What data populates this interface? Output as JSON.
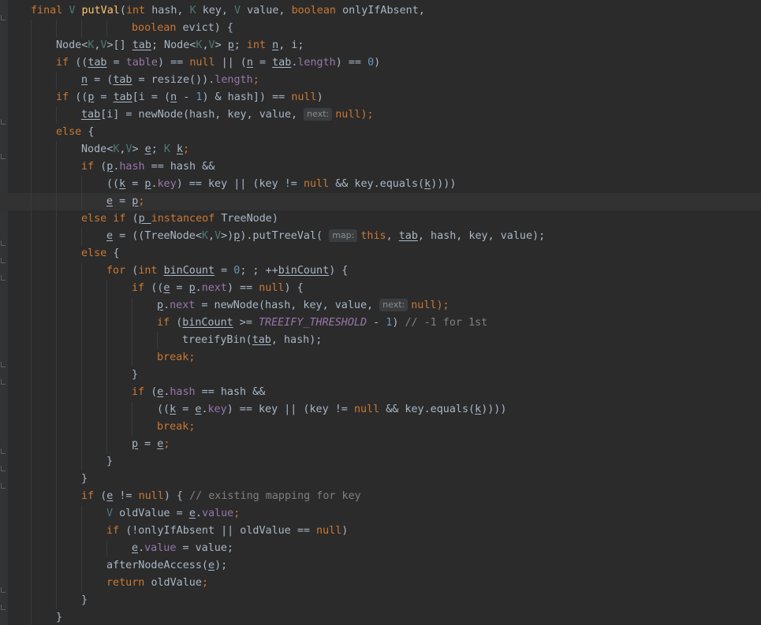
{
  "lines": [
    {
      "indent": 1,
      "tokens": [
        [
          "final ",
          "kw"
        ],
        [
          "V ",
          "tp"
        ],
        [
          "putVal",
          "fn"
        ],
        [
          "(",
          ""
        ],
        [
          "int ",
          "kw"
        ],
        [
          "hash, ",
          ""
        ],
        [
          "K ",
          "tp"
        ],
        [
          "key, ",
          ""
        ],
        [
          "V ",
          "tp"
        ],
        [
          "value, ",
          ""
        ],
        [
          "boolean ",
          "kw"
        ],
        [
          "onlyIfAbsent,",
          ""
        ]
      ]
    },
    {
      "indent": 5,
      "tokens": [
        [
          "boolean ",
          "kw"
        ],
        [
          "evict) {",
          ""
        ]
      ]
    },
    {
      "indent": 2,
      "tokens": [
        [
          "Node<",
          ""
        ],
        [
          "K",
          "tp"
        ],
        [
          ",",
          ""
        ],
        [
          "V",
          "tp"
        ],
        [
          ">[] ",
          ""
        ],
        [
          "tab",
          "ul"
        ],
        [
          "; Node<",
          ""
        ],
        [
          "K",
          "tp"
        ],
        [
          ",",
          ""
        ],
        [
          "V",
          "tp"
        ],
        [
          "> ",
          ""
        ],
        [
          "p",
          "ul"
        ],
        [
          "; ",
          ""
        ],
        [
          "int ",
          "kw"
        ],
        [
          "n",
          "ul"
        ],
        [
          ", i;",
          ""
        ]
      ]
    },
    {
      "indent": 2,
      "tokens": [
        [
          "if ",
          "kw"
        ],
        [
          "((",
          ""
        ],
        [
          "tab",
          "ul"
        ],
        [
          " = ",
          ""
        ],
        [
          "table",
          "fld"
        ],
        [
          ") == ",
          ""
        ],
        [
          "null",
          "kw"
        ],
        [
          " || (",
          ""
        ],
        [
          "n",
          "ul"
        ],
        [
          " = ",
          ""
        ],
        [
          "tab",
          "ul"
        ],
        [
          ".",
          ""
        ],
        [
          "length",
          "fld"
        ],
        [
          ") == ",
          ""
        ],
        [
          "0",
          "num"
        ],
        [
          ")",
          ""
        ]
      ]
    },
    {
      "indent": 3,
      "tokens": [
        [
          "n",
          "ul"
        ],
        [
          " = (",
          ""
        ],
        [
          "tab",
          "ul"
        ],
        [
          " = resize()).",
          ""
        ],
        [
          "length",
          "fld"
        ],
        [
          ";",
          "kw"
        ]
      ]
    },
    {
      "indent": 2,
      "tokens": [
        [
          "if ",
          "kw"
        ],
        [
          "((",
          ""
        ],
        [
          "p",
          "ul"
        ],
        [
          " = ",
          ""
        ],
        [
          "tab",
          "ul"
        ],
        [
          "[i = (",
          ""
        ],
        [
          "n",
          "ul"
        ],
        [
          " - ",
          ""
        ],
        [
          "1",
          "num"
        ],
        [
          ") & hash]) == ",
          ""
        ],
        [
          "null",
          "kw"
        ],
        [
          ")",
          ""
        ]
      ]
    },
    {
      "indent": 3,
      "tokens": [
        [
          "tab",
          "ul"
        ],
        [
          "[i] = newNode(hash, key, value, ",
          ""
        ],
        [
          "next:",
          "hint"
        ],
        [
          "null",
          "kw"
        ],
        [
          ");",
          "kw"
        ]
      ]
    },
    {
      "indent": 2,
      "tokens": [
        [
          "else ",
          "kw"
        ],
        [
          "{",
          ""
        ]
      ]
    },
    {
      "indent": 3,
      "tokens": [
        [
          "Node<",
          ""
        ],
        [
          "K",
          "tp"
        ],
        [
          ",",
          ""
        ],
        [
          "V",
          "tp"
        ],
        [
          "> ",
          ""
        ],
        [
          "e",
          "ul"
        ],
        [
          "; ",
          ""
        ],
        [
          "K ",
          "tp"
        ],
        [
          "k",
          "ul"
        ],
        [
          ";",
          "kw"
        ]
      ]
    },
    {
      "indent": 3,
      "tokens": [
        [
          "if ",
          "kw"
        ],
        [
          "(",
          ""
        ],
        [
          "p",
          "ul"
        ],
        [
          ".",
          ""
        ],
        [
          "hash",
          "fld"
        ],
        [
          " == hash &&",
          ""
        ]
      ]
    },
    {
      "indent": 4,
      "tokens": [
        [
          "((",
          ""
        ],
        [
          "k",
          "ul"
        ],
        [
          " = ",
          ""
        ],
        [
          "p",
          "ul"
        ],
        [
          ".",
          ""
        ],
        [
          "key",
          "fld"
        ],
        [
          ") == key || (key != ",
          ""
        ],
        [
          "null ",
          "kw"
        ],
        [
          "&& key.equals(",
          ""
        ],
        [
          "k",
          "ul"
        ],
        [
          ")))) ",
          ""
        ]
      ]
    },
    {
      "indent": 4,
      "current": true,
      "tokens": [
        [
          "e",
          "ul"
        ],
        [
          " = ",
          ""
        ],
        [
          "p",
          "ul"
        ],
        [
          ";",
          "kw"
        ]
      ]
    },
    {
      "indent": 3,
      "tokens": [
        [
          "else if ",
          "kw"
        ],
        [
          "(",
          ""
        ],
        [
          "p ",
          "ul"
        ],
        [
          "instanceof ",
          "kw"
        ],
        [
          "TreeNode)",
          ""
        ]
      ]
    },
    {
      "indent": 4,
      "tokens": [
        [
          "e",
          "ul"
        ],
        [
          " = ((TreeNode<",
          ""
        ],
        [
          "K",
          "tp"
        ],
        [
          ",",
          ""
        ],
        [
          "V",
          "tp"
        ],
        [
          ">)",
          ""
        ],
        [
          "p",
          "ul"
        ],
        [
          ").putTreeVal( ",
          ""
        ],
        [
          "map:",
          "hint"
        ],
        [
          "this",
          "kw"
        ],
        [
          ", ",
          ""
        ],
        [
          "tab",
          "ul"
        ],
        [
          ", hash, key, value);",
          ""
        ]
      ]
    },
    {
      "indent": 3,
      "tokens": [
        [
          "else ",
          "kw"
        ],
        [
          "{",
          ""
        ]
      ]
    },
    {
      "indent": 4,
      "tokens": [
        [
          "for ",
          "kw"
        ],
        [
          "(",
          ""
        ],
        [
          "int ",
          "kw"
        ],
        [
          "binCount",
          "ul"
        ],
        [
          " = ",
          ""
        ],
        [
          "0",
          "num"
        ],
        [
          "; ; ++",
          ""
        ],
        [
          "binCount",
          "ul"
        ],
        [
          ") {",
          ""
        ]
      ]
    },
    {
      "indent": 5,
      "tokens": [
        [
          "if ",
          "kw"
        ],
        [
          "((",
          ""
        ],
        [
          "e",
          "ul"
        ],
        [
          " = ",
          ""
        ],
        [
          "p",
          "ul"
        ],
        [
          ".",
          ""
        ],
        [
          "next",
          "fld"
        ],
        [
          ") == ",
          ""
        ],
        [
          "null",
          "kw"
        ],
        [
          ") {",
          ""
        ]
      ]
    },
    {
      "indent": 6,
      "tokens": [
        [
          "p",
          "ul"
        ],
        [
          ".",
          ""
        ],
        [
          "next",
          "fld"
        ],
        [
          " = newNode(hash, key, value, ",
          ""
        ],
        [
          "next:",
          "hint"
        ],
        [
          "null",
          "kw"
        ],
        [
          ");",
          "kw"
        ]
      ]
    },
    {
      "indent": 6,
      "tokens": [
        [
          "if ",
          "kw"
        ],
        [
          "(",
          ""
        ],
        [
          "binCount",
          "ul"
        ],
        [
          " >= ",
          ""
        ],
        [
          "TREEIFY_THRESHOLD",
          "cst"
        ],
        [
          " - ",
          ""
        ],
        [
          "1",
          "num"
        ],
        [
          ") ",
          ""
        ],
        [
          "// -1 for 1st",
          "cmt"
        ]
      ]
    },
    {
      "indent": 7,
      "tokens": [
        [
          "treeifyBin(",
          ""
        ],
        [
          "tab",
          "ul"
        ],
        [
          ", hash);",
          ""
        ]
      ]
    },
    {
      "indent": 6,
      "tokens": [
        [
          "break",
          "kw"
        ],
        [
          ";",
          "kw"
        ]
      ]
    },
    {
      "indent": 5,
      "tokens": [
        [
          "}",
          ""
        ]
      ]
    },
    {
      "indent": 5,
      "tokens": [
        [
          "if ",
          "kw"
        ],
        [
          "(",
          ""
        ],
        [
          "e",
          "ul"
        ],
        [
          ".",
          ""
        ],
        [
          "hash",
          "fld"
        ],
        [
          " == hash &&",
          ""
        ]
      ]
    },
    {
      "indent": 6,
      "tokens": [
        [
          "((",
          ""
        ],
        [
          "k",
          "ul"
        ],
        [
          " = ",
          ""
        ],
        [
          "e",
          "ul"
        ],
        [
          ".",
          ""
        ],
        [
          "key",
          "fld"
        ],
        [
          ") == key || (key != ",
          ""
        ],
        [
          "null ",
          "kw"
        ],
        [
          "&& key.equals(",
          ""
        ],
        [
          "k",
          "ul"
        ],
        [
          "))))",
          ""
        ]
      ]
    },
    {
      "indent": 6,
      "tokens": [
        [
          "break",
          "kw"
        ],
        [
          ";",
          "kw"
        ]
      ]
    },
    {
      "indent": 5,
      "tokens": [
        [
          "p",
          "ul"
        ],
        [
          " = ",
          ""
        ],
        [
          "e",
          "ul"
        ],
        [
          ";",
          "kw"
        ]
      ]
    },
    {
      "indent": 4,
      "tokens": [
        [
          "}",
          ""
        ]
      ]
    },
    {
      "indent": 3,
      "tokens": [
        [
          "}",
          ""
        ]
      ]
    },
    {
      "indent": 3,
      "tokens": [
        [
          "if ",
          "kw"
        ],
        [
          "(",
          ""
        ],
        [
          "e",
          "ul"
        ],
        [
          " != ",
          ""
        ],
        [
          "null",
          "kw"
        ],
        [
          ") { ",
          ""
        ],
        [
          "// existing mapping for key",
          "cmt"
        ]
      ]
    },
    {
      "indent": 4,
      "tokens": [
        [
          "V ",
          "tp"
        ],
        [
          "oldValue = ",
          ""
        ],
        [
          "e",
          "ul"
        ],
        [
          ".",
          ""
        ],
        [
          "value",
          "fld"
        ],
        [
          ";",
          "kw"
        ]
      ]
    },
    {
      "indent": 4,
      "tokens": [
        [
          "if ",
          "kw"
        ],
        [
          "(!onlyIfAbsent || oldValue == ",
          ""
        ],
        [
          "null",
          "kw"
        ],
        [
          ")",
          ""
        ]
      ]
    },
    {
      "indent": 5,
      "tokens": [
        [
          "e",
          "ul"
        ],
        [
          ".",
          ""
        ],
        [
          "value",
          "fld"
        ],
        [
          " = value;",
          ""
        ]
      ]
    },
    {
      "indent": 4,
      "tokens": [
        [
          "afterNodeAccess(",
          ""
        ],
        [
          "e",
          "ul"
        ],
        [
          ");",
          ""
        ]
      ]
    },
    {
      "indent": 4,
      "tokens": [
        [
          "return ",
          "kw"
        ],
        [
          "oldValue",
          ""
        ],
        [
          ";",
          "kw"
        ]
      ]
    },
    {
      "indent": 3,
      "tokens": [
        [
          "}",
          ""
        ]
      ]
    },
    {
      "indent": 2,
      "tokens": [
        [
          "}",
          ""
        ]
      ]
    }
  ]
}
